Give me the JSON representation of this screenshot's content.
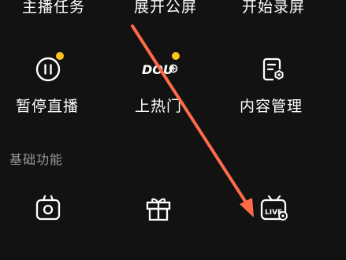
{
  "top_row": [
    {
      "label": "主播任务"
    },
    {
      "label": "展开公屏"
    },
    {
      "label": "开始录屏"
    }
  ],
  "tools": [
    {
      "label": "暂停直播",
      "icon": "pause-icon",
      "badge": true
    },
    {
      "label": "上热门",
      "icon": "dou-plus-icon",
      "icon_text": "DOU",
      "badge": true
    },
    {
      "label": "内容管理",
      "icon": "content-settings-icon",
      "badge": false
    }
  ],
  "section": {
    "title": "基础功能"
  },
  "basic_row": [
    {
      "icon": "camera-icon"
    },
    {
      "icon": "gift-icon"
    },
    {
      "icon": "live-tv-settings-icon",
      "icon_text": "LIVE"
    }
  ],
  "colors": {
    "background": "#121212",
    "text": "#ffffff",
    "muted_text": "#9a9a9a",
    "badge": "#ffc21a",
    "annotation_arrow": "#ff6b4a"
  }
}
